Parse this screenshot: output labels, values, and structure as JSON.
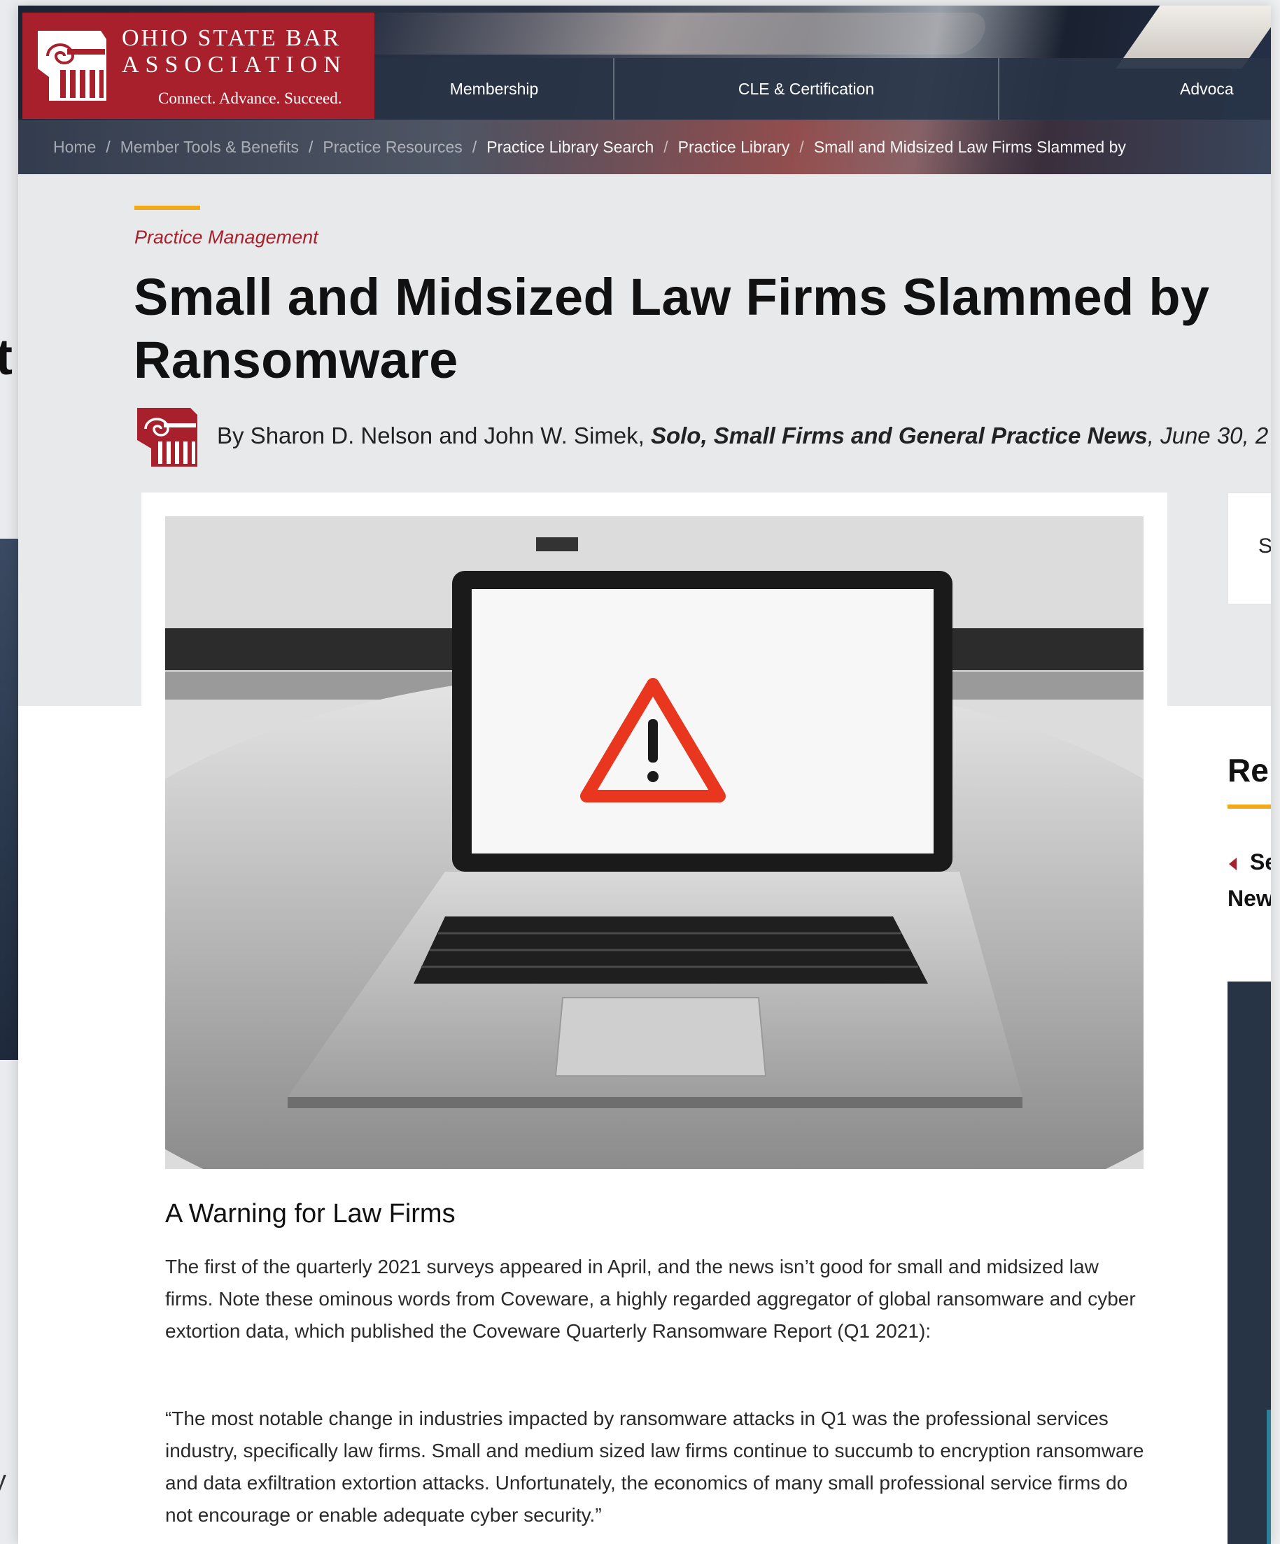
{
  "logo": {
    "line1": "OHIO STATE BAR",
    "line2": "ASSOCIATION",
    "tagline": "Connect. Advance. Succeed."
  },
  "nav": {
    "items": [
      "Membership",
      "CLE & Certification",
      "Advoca"
    ]
  },
  "breadcrumb": [
    "Home",
    "Member Tools & Benefits",
    "Practice Resources",
    "Practice Library Search",
    "Practice Library",
    "Small and Midsized Law Firms Slammed by"
  ],
  "article": {
    "category": "Practice Management",
    "title": "Small and Midsized Law Firms Slammed by Ransomware",
    "byline_prefix": "By Sharon D. Nelson and John W. Simek, ",
    "publication": "Solo, Small Firms and General Practice News",
    "date": ", June 30, 2",
    "section_heading": "A Warning for Law Firms",
    "paragraph1": "The first of the quarterly 2021 surveys appeared in April, and the news isn’t good for small and midsized law firms. Note these ominous words from Coveware, a highly regarded aggregator of global ransomware and cyber extortion data, which published the Coveware Quarterly Ransomware Report (Q1 2021):",
    "quote": "“The most notable change in industries impacted by ransomware attacks in Q1 was the professional services industry, specifically law firms. Small and medium sized law firms continue to succumb to encryption ransomware and data exfiltration extortion attacks. Unfortunately, the economics of many small professional service firms do not encourage or enable adequate cyber security.”"
  },
  "sidebar": {
    "box_letter": "S",
    "heading_fragment": "Re",
    "link_line1": "Se",
    "link_line2": "New"
  },
  "background": {
    "left_letter_top": "t",
    "left_letter_bottom": "y"
  },
  "colors": {
    "brand_red": "#a8202c",
    "accent_gold": "#f2a917",
    "nav_dark": "#283446",
    "warning_red": "#e9361f"
  },
  "icons": {
    "logo_mark": "ionic-column-icon",
    "hero": "laptop-warning-icon"
  }
}
